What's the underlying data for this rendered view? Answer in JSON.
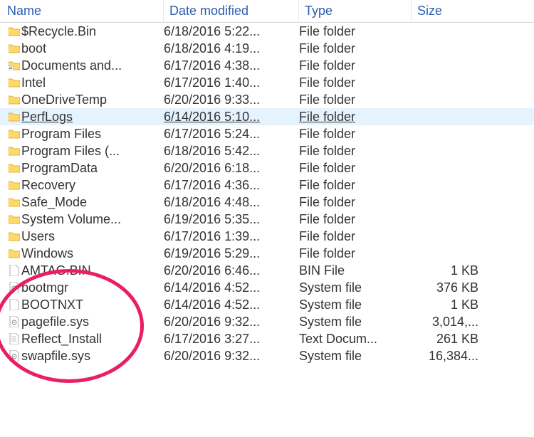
{
  "columns": {
    "name": "Name",
    "date": "Date modified",
    "type": "Type",
    "size": "Size"
  },
  "files": [
    {
      "name": "$Recycle.Bin",
      "date": "6/18/2016 5:22...",
      "type": "File folder",
      "size": "",
      "icon": "folder"
    },
    {
      "name": "boot",
      "date": "6/18/2016 4:19...",
      "type": "File folder",
      "size": "",
      "icon": "folder"
    },
    {
      "name": "Documents and...",
      "date": "6/17/2016 4:38...",
      "type": "File folder",
      "size": "",
      "icon": "folder-shortcut"
    },
    {
      "name": "Intel",
      "date": "6/17/2016 1:40...",
      "type": "File folder",
      "size": "",
      "icon": "folder"
    },
    {
      "name": "OneDriveTemp",
      "date": "6/20/2016 9:33...",
      "type": "File folder",
      "size": "",
      "icon": "folder"
    },
    {
      "name": "PerfLogs",
      "date": "6/14/2016 5:10...",
      "type": "File folder",
      "size": "",
      "icon": "folder",
      "selected": true
    },
    {
      "name": "Program Files",
      "date": "6/17/2016 5:24...",
      "type": "File folder",
      "size": "",
      "icon": "folder"
    },
    {
      "name": "Program Files (...",
      "date": "6/18/2016 5:42...",
      "type": "File folder",
      "size": "",
      "icon": "folder"
    },
    {
      "name": "ProgramData",
      "date": "6/20/2016 6:18...",
      "type": "File folder",
      "size": "",
      "icon": "folder"
    },
    {
      "name": "Recovery",
      "date": "6/17/2016 4:36...",
      "type": "File folder",
      "size": "",
      "icon": "folder"
    },
    {
      "name": "Safe_Mode",
      "date": "6/18/2016 4:48...",
      "type": "File folder",
      "size": "",
      "icon": "folder"
    },
    {
      "name": "System Volume...",
      "date": "6/19/2016 5:35...",
      "type": "File folder",
      "size": "",
      "icon": "folder"
    },
    {
      "name": "Users",
      "date": "6/17/2016 1:39...",
      "type": "File folder",
      "size": "",
      "icon": "folder"
    },
    {
      "name": "Windows",
      "date": "6/19/2016 5:29...",
      "type": "File folder",
      "size": "",
      "icon": "folder"
    },
    {
      "name": "AMTAG.BIN",
      "date": "6/20/2016 6:46...",
      "type": "BIN File",
      "size": "1 KB",
      "icon": "file"
    },
    {
      "name": "bootmgr",
      "date": "6/14/2016 4:52...",
      "type": "System file",
      "size": "376 KB",
      "icon": "system-file"
    },
    {
      "name": "BOOTNXT",
      "date": "6/14/2016 4:52...",
      "type": "System file",
      "size": "1 KB",
      "icon": "file"
    },
    {
      "name": "pagefile.sys",
      "date": "6/20/2016 9:32...",
      "type": "System file",
      "size": "3,014,...",
      "icon": "system-file"
    },
    {
      "name": "Reflect_Install",
      "date": "6/17/2016 3:27...",
      "type": "Text Docum...",
      "size": "261 KB",
      "icon": "text-file"
    },
    {
      "name": "swapfile.sys",
      "date": "6/20/2016 9:32...",
      "type": "System file",
      "size": "16,384...",
      "icon": "system-file"
    }
  ]
}
